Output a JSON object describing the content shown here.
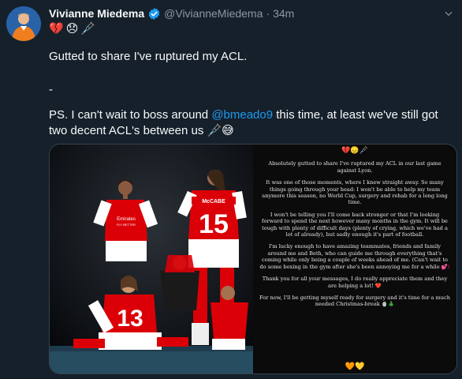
{
  "tweet": {
    "author_name": "Vivianne Miedema",
    "author_handle": "@VivianneMiedema",
    "separator": "·",
    "time": "34m",
    "status_emojis": [
      "💔",
      "😞",
      "🩼"
    ],
    "line1": "Gutted to share I've ruptured my ACL.",
    "line2": "-",
    "line3_before": "PS. I can't wait to boss around ",
    "mention": "@bmeado9",
    "line3_after": " this time, at least we've still got two decent ACL's between us ",
    "line3_emojis": "🩼😅"
  },
  "story": {
    "top_emojis": "💔😞🩼",
    "paragraphs": [
      "Absolutely gutted to share I've ruptured my ACL in our last game against Lyon.",
      "It was one of those moments, where I knew straight away. So many things going through your head: I won't be able to help my team anymore this season, no World Cup, surgery and rehab for a long long time.",
      "I won't be telling you I'll come back stronger or that I'm looking forward to spend the next however many months in the gym. It will be tough with plenty of difficult days (plenty of crying, which we've had a lot of already), but sadly enough it's part of football.",
      "I'm lucky enough to have amazing teammates, friends and family around me and Beth, who can guide me through everything that's coming while only being a couple of weeks ahead of me. (Can't wait to do some boxing in the gym after she's been annoying me for a while",
      "Thank you for all your messages, I do really appreciate them and they are helping a lot!",
      "For now, I'll be getting myself ready for surgery and it's time for a much needed Christmas-break"
    ],
    "para4_emoji": "💕)",
    "para5_emoji": "❤️",
    "para6_emoji": "🍵🎄",
    "bottom_emojis": "🧡💛"
  },
  "photo": {
    "sponsor": "Emirates",
    "sponsor_sub": "FLY BETTER",
    "jersey_name": "McCABE",
    "numbers": [
      "15",
      "13"
    ]
  },
  "colors": {
    "background": "#15202b",
    "link": "#1d9bf0",
    "muted": "#8b98a5",
    "verified": "#1d9bf0",
    "arsenal_red": "#db0007"
  }
}
